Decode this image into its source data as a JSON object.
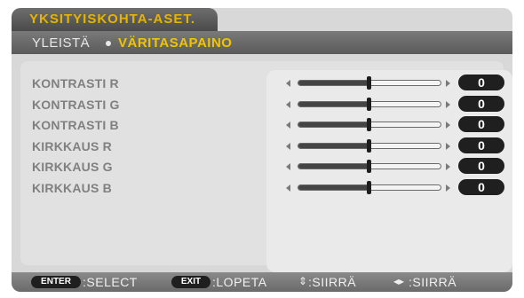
{
  "header": {
    "title": "YKSITYISKOHTA-ASET.",
    "breadcrumb_parent": "YLEISTÄ",
    "breadcrumb_active": "VÄRITASAPAINO"
  },
  "rows": [
    {
      "label": "KONTRASTI R",
      "value": "0",
      "level": 0.5
    },
    {
      "label": "KONTRASTI G",
      "value": "0",
      "level": 0.5
    },
    {
      "label": "KONTRASTI B",
      "value": "0",
      "level": 0.5
    },
    {
      "label": "KIRKKAUS R",
      "value": "0",
      "level": 0.5
    },
    {
      "label": "KIRKKAUS G",
      "value": "0",
      "level": 0.5
    },
    {
      "label": "KIRKKAUS B",
      "value": "0",
      "level": 0.5
    }
  ],
  "footer": {
    "enter_key": "ENTER",
    "enter_label": ":SELECT",
    "exit_key": "EXIT",
    "exit_label": ":LOPETA",
    "updown_icon": "⇕",
    "updown_label": ":SIIRRÄ",
    "leftright_icon": "◂▸",
    "leftright_label": ":SIIRRÄ"
  },
  "colors": {
    "accent": "#f2c400",
    "value_badge": "#1f1f1f"
  }
}
